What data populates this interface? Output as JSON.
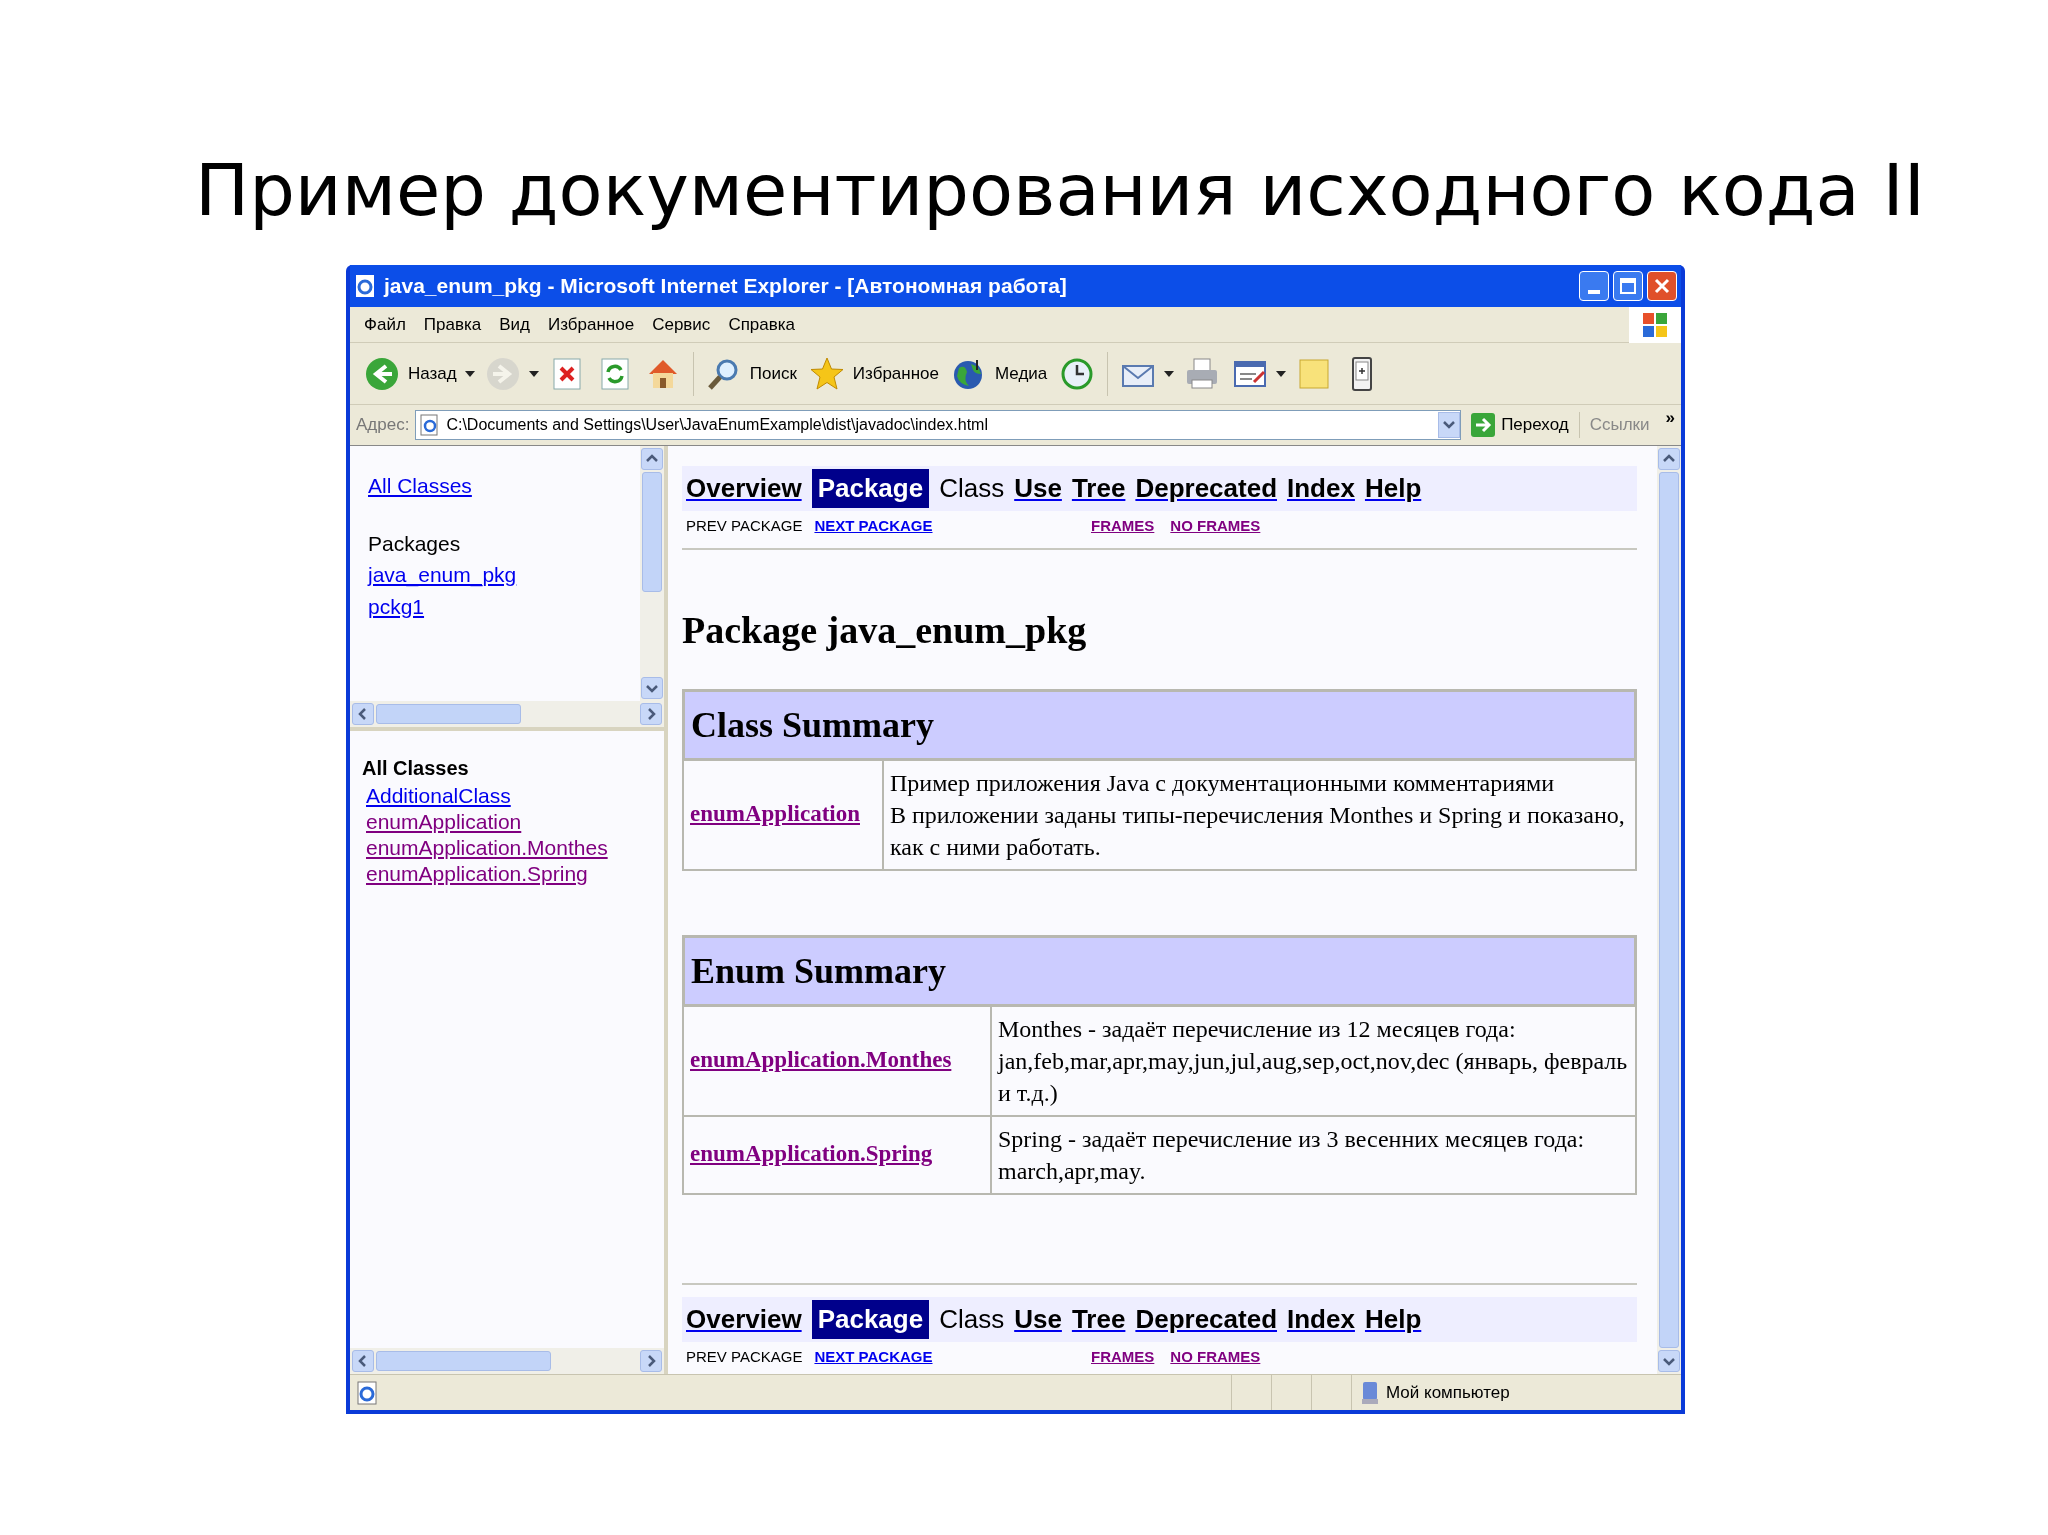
{
  "slide_title": "Пример документирования исходного кода II",
  "window": {
    "title": "java_enum_pkg - Microsoft Internet Explorer - [Автономная работа]"
  },
  "menu": [
    "Файл",
    "Правка",
    "Вид",
    "Избранное",
    "Сервис",
    "Справка"
  ],
  "toolbar": [
    {
      "kind": "back",
      "label": "Назад",
      "dropdown": true,
      "disabled": false
    },
    {
      "kind": "forward",
      "dropdown": true,
      "disabled": true
    },
    {
      "kind": "stop",
      "dropdown": false,
      "disabled": false
    },
    {
      "kind": "refresh",
      "dropdown": false,
      "disabled": false
    },
    {
      "kind": "home",
      "dropdown": false,
      "disabled": false
    },
    {
      "kind": "separator"
    },
    {
      "kind": "search",
      "label": "Поиск",
      "dropdown": false,
      "disabled": false
    },
    {
      "kind": "favorites",
      "label": "Избранное",
      "dropdown": false,
      "disabled": false
    },
    {
      "kind": "media",
      "label": "Медиа",
      "dropdown": false,
      "disabled": false
    },
    {
      "kind": "history",
      "dropdown": false,
      "disabled": false
    },
    {
      "kind": "separator"
    },
    {
      "kind": "mail",
      "dropdown": true,
      "disabled": false
    },
    {
      "kind": "print",
      "dropdown": false,
      "disabled": false
    },
    {
      "kind": "edit",
      "dropdown": true,
      "disabled": false
    },
    {
      "kind": "note",
      "dropdown": false,
      "disabled": false
    },
    {
      "kind": "messenger",
      "dropdown": false,
      "disabled": false
    }
  ],
  "address": {
    "label": "Адрес:",
    "value": "C:\\Documents and Settings\\User\\JavaEnumExample\\dist\\javadoc\\index.html",
    "go": "Переход",
    "links": "Ссылки",
    "more": "»"
  },
  "packages_frame": {
    "all_classes": "All Classes",
    "heading": "Packages",
    "packages": [
      {
        "label": "java_enum_pkg",
        "visited": false
      },
      {
        "label": "pckg1",
        "visited": false
      }
    ]
  },
  "classes_frame": {
    "heading": "All Classes",
    "classes": [
      {
        "label": "AdditionalClass",
        "visited": false
      },
      {
        "label": "enumApplication",
        "visited": true
      },
      {
        "label": "enumApplication.Monthes",
        "visited": true
      },
      {
        "label": "enumApplication.Spring",
        "visited": true
      }
    ]
  },
  "doc": {
    "nav_top": {
      "items": [
        {
          "label": "Overview",
          "selected": false,
          "disabled": false
        },
        {
          "label": "Package",
          "selected": true,
          "disabled": false
        },
        {
          "label": "Class",
          "selected": false,
          "disabled": true
        },
        {
          "label": "Use",
          "selected": false,
          "disabled": false
        },
        {
          "label": "Tree",
          "selected": false,
          "disabled": false
        },
        {
          "label": "Deprecated",
          "selected": false,
          "disabled": false
        },
        {
          "label": "Index",
          "selected": false,
          "disabled": false
        },
        {
          "label": "Help",
          "selected": false,
          "disabled": false
        }
      ],
      "left": [
        {
          "label": "PREV PACKAGE",
          "disabled": true
        },
        {
          "label": "NEXT PACKAGE",
          "disabled": false,
          "visited": false
        }
      ],
      "right": [
        {
          "label": "FRAMES",
          "disabled": false,
          "visited": true
        },
        {
          "label": "NO FRAMES",
          "disabled": false,
          "visited": true
        }
      ]
    },
    "title": "Package java_enum_pkg",
    "sections": [
      {
        "title": "Class Summary",
        "rows": [
          {
            "name": "enumApplication",
            "visited": true,
            "description": [
              "Пример приложения Java с документационными комментариями",
              "В приложении заданы типы-перечисления Monthes и Spring и показано, как с ними работать."
            ]
          }
        ]
      },
      {
        "title": "Enum Summary",
        "rows": [
          {
            "name": "enumApplication.Monthes",
            "visited": true,
            "description": [
              "Monthes - задаёт перечисление из 12 месяцев года: jan,feb,mar,apr,may,jun,jul,aug,sep,oct,nov,dec (январь, февраль и т.д.)"
            ]
          },
          {
            "name": "enumApplication.Spring",
            "visited": true,
            "description": [
              "Spring - задаёт перечисление из 3 весенних месяцев года: march,apr,may."
            ]
          }
        ]
      }
    ],
    "nav_bottom": {
      "items": [
        {
          "label": "Overview",
          "selected": false,
          "disabled": false
        },
        {
          "label": "Package",
          "selected": true,
          "disabled": false
        },
        {
          "label": "Class",
          "selected": false,
          "disabled": true
        },
        {
          "label": "Use",
          "selected": false,
          "disabled": false
        },
        {
          "label": "Tree",
          "selected": false,
          "disabled": false
        },
        {
          "label": "Deprecated",
          "selected": false,
          "disabled": false
        },
        {
          "label": "Index",
          "selected": false,
          "disabled": false
        },
        {
          "label": "Help",
          "selected": false,
          "disabled": false
        }
      ],
      "left": [
        {
          "label": "PREV PACKAGE",
          "disabled": true
        },
        {
          "label": "NEXT PACKAGE",
          "disabled": false,
          "visited": false
        }
      ],
      "right": [
        {
          "label": "FRAMES",
          "disabled": false,
          "visited": true
        },
        {
          "label": "NO FRAMES",
          "disabled": false,
          "visited": true
        }
      ]
    }
  },
  "status_bar": {
    "zone": "Мой компьютер"
  }
}
